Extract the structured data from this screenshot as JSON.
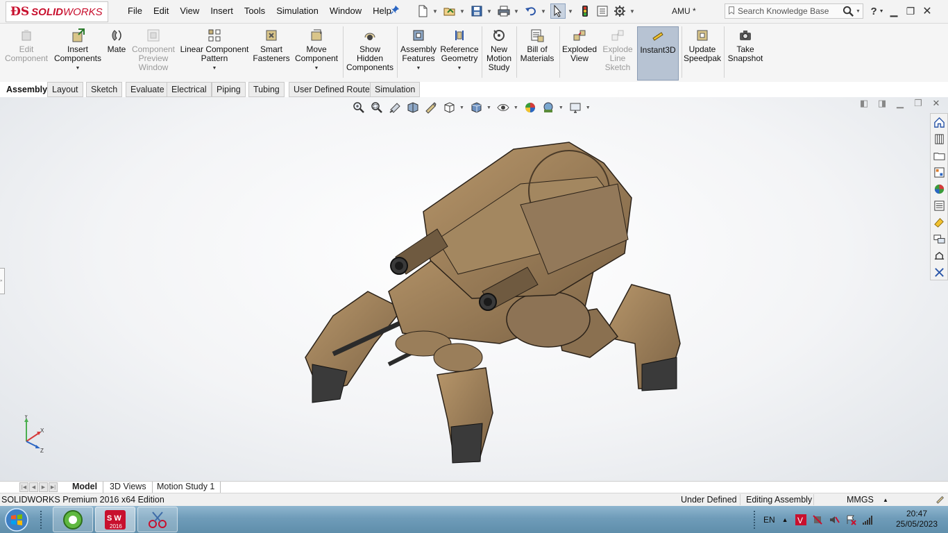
{
  "app": {
    "logo_text_solid": "SOLID",
    "logo_text_works": "WORKS",
    "document_title": "AMU *",
    "brand_color": "#c8102e"
  },
  "menu": [
    "File",
    "Edit",
    "View",
    "Insert",
    "Tools",
    "Simulation",
    "Window",
    "Help"
  ],
  "search": {
    "placeholder": "Search Knowledge Base"
  },
  "commands": [
    {
      "label": "Edit Component",
      "icon": "edit-component-icon",
      "enabled": false
    },
    {
      "label": "Insert Components",
      "icon": "insert-components-icon",
      "enabled": true
    },
    {
      "label": "Mate",
      "icon": "mate-icon",
      "enabled": true
    },
    {
      "label": "Component Preview Window",
      "icon": "component-preview-icon",
      "enabled": false
    },
    {
      "label": "Linear Component Pattern",
      "icon": "linear-pattern-icon",
      "enabled": true
    },
    {
      "label": "Smart Fasteners",
      "icon": "smart-fasteners-icon",
      "enabled": true
    },
    {
      "label": "Move Component",
      "icon": "move-component-icon",
      "enabled": true
    },
    {
      "label": "Show Hidden Components",
      "icon": "show-hidden-icon",
      "enabled": true
    },
    {
      "label": "Assembly Features",
      "icon": "assembly-features-icon",
      "enabled": true
    },
    {
      "label": "Reference Geometry",
      "icon": "reference-geometry-icon",
      "enabled": true
    },
    {
      "label": "New Motion Study",
      "icon": "motion-study-icon",
      "enabled": true
    },
    {
      "label": "Bill of Materials",
      "icon": "bill-of-materials-icon",
      "enabled": true
    },
    {
      "label": "Exploded View",
      "icon": "exploded-view-icon",
      "enabled": true
    },
    {
      "label": "Explode Line Sketch",
      "icon": "explode-line-icon",
      "enabled": false
    },
    {
      "label": "Instant3D",
      "icon": "instant3d-icon",
      "enabled": true,
      "active": true
    },
    {
      "label": "Update Speedpak",
      "icon": "speedpak-icon",
      "enabled": true
    },
    {
      "label": "Take Snapshot",
      "icon": "snapshot-icon",
      "enabled": true
    }
  ],
  "tabs": [
    "Assembly",
    "Layout",
    "Sketch",
    "Evaluate",
    "Electrical",
    "Piping",
    "Tubing",
    "User Defined Route",
    "Simulation"
  ],
  "active_tab": "Assembly",
  "triad": {
    "x": "X",
    "y": "Y",
    "z": "Z"
  },
  "bottom_tabs": [
    "Model",
    "3D Views",
    "Motion Study 1"
  ],
  "status": {
    "edition": "SOLIDWORKS Premium 2016 x64 Edition",
    "definition": "Under Defined",
    "mode": "Editing Assembly",
    "units": "MMGS"
  },
  "taskbar": {
    "sw_year": "2016",
    "language": "EN",
    "time": "20:47",
    "date": "25/05/2023"
  }
}
